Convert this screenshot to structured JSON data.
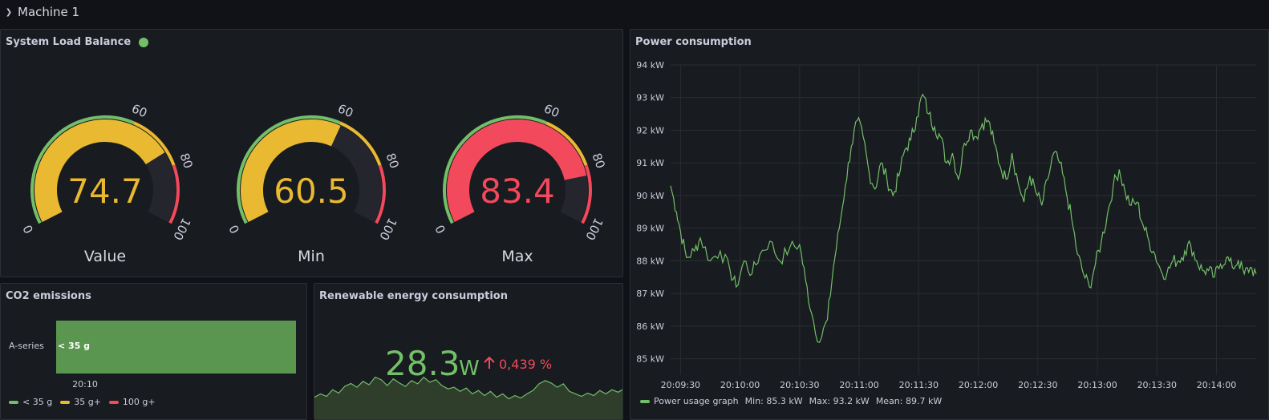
{
  "row": {
    "title": "Machine 1",
    "chevron_icon": "chevron-down-icon"
  },
  "colors": {
    "green": "#73bf69",
    "yellow": "#e8b931",
    "red": "#f2495c",
    "track": "#25262d"
  },
  "load_panel": {
    "title": "System Load Balance",
    "status_color": "#73bf69",
    "gauges": [
      {
        "label": "Value",
        "value": 74.7,
        "display": "74.7",
        "color": "#e8b931"
      },
      {
        "label": "Min",
        "value": 60.5,
        "display": "60.5",
        "color": "#e8b931"
      },
      {
        "label": "Max",
        "value": 83.4,
        "display": "83.4",
        "color": "#f2495c"
      }
    ],
    "min": 0,
    "max": 100,
    "thresholds": [
      {
        "from": 0,
        "to": 60,
        "color": "#73bf69"
      },
      {
        "from": 60,
        "to": 80,
        "color": "#e8b931"
      },
      {
        "from": 80,
        "to": 100,
        "color": "#f2495c"
      }
    ],
    "tick_labels": [
      "0",
      "60",
      "80",
      "100"
    ]
  },
  "co2_panel": {
    "title": "CO2 emissions",
    "series_label": "A-series",
    "bar_label": "< 35 g",
    "bar_color": "#5b9650",
    "x_tick": "20:10",
    "legend": [
      {
        "label": "< 35 g",
        "color": "#73bf69"
      },
      {
        "label": "35 g+",
        "color": "#e8b931"
      },
      {
        "label": "100 g+",
        "color": "#f2495c"
      }
    ]
  },
  "renew_panel": {
    "title": "Renewable energy consumption",
    "value": "28.3",
    "unit": "W",
    "change": "0,439 %",
    "value_color": "#73bf69",
    "change_color": "#f2495c",
    "arrow_icon": "arrow-up-icon"
  },
  "power_panel": {
    "title": "Power consumption",
    "legend": {
      "name": "Power usage graph",
      "min": "Min: 85.3 kW",
      "max": "Max: 93.2 kW",
      "mean": "Mean: 89.7 kW",
      "color": "#73bf69"
    }
  },
  "chart_data": [
    {
      "type": "line",
      "title": "Power consumption",
      "ylim": [
        84.5,
        94
      ],
      "y_ticks": [
        "85 kW",
        "86 kW",
        "87 kW",
        "88 kW",
        "89 kW",
        "90 kW",
        "91 kW",
        "92 kW",
        "93 kW",
        "94 kW"
      ],
      "x_ticks": [
        "20:09:30",
        "20:10:00",
        "20:10:30",
        "20:11:00",
        "20:11:30",
        "20:12:00",
        "20:12:30",
        "20:13:00",
        "20:13:30",
        "20:14:00"
      ],
      "x_tick_seconds": [
        0,
        30,
        60,
        90,
        120,
        150,
        180,
        210,
        240,
        270
      ],
      "x_range_seconds": [
        -5,
        290
      ],
      "grid": true,
      "series": [
        {
          "name": "Power usage graph",
          "color": "#73bf69",
          "x": [
            -5,
            -2,
            0,
            3,
            7,
            10,
            15,
            20,
            25,
            28,
            32,
            36,
            40,
            45,
            50,
            55,
            60,
            63,
            66,
            70,
            74,
            77,
            80,
            83,
            86,
            89,
            92,
            95,
            98,
            101,
            104,
            107,
            110,
            113,
            116,
            119,
            122,
            125,
            128,
            131,
            134,
            137,
            140,
            143,
            146,
            149,
            152,
            155,
            158,
            161,
            164,
            167,
            170,
            173,
            176,
            179,
            182,
            185,
            188,
            191,
            194,
            197,
            200,
            203,
            206,
            209,
            212,
            215,
            218,
            221,
            224,
            227,
            230,
            233,
            236,
            239,
            242,
            245,
            248,
            251,
            254,
            257,
            260,
            263,
            266,
            269,
            272,
            275,
            278,
            281,
            284,
            287,
            290
          ],
          "y": [
            90.3,
            89.5,
            88.9,
            88.1,
            88.3,
            88.7,
            88.0,
            88.3,
            87.7,
            87.2,
            88.0,
            87.6,
            88.2,
            88.6,
            88.0,
            88.4,
            88.5,
            87.4,
            86.4,
            85.5,
            86.2,
            87.8,
            89.0,
            90.3,
            91.5,
            92.3,
            91.8,
            90.7,
            90.2,
            91.0,
            90.5,
            90.0,
            90.6,
            91.4,
            91.7,
            92.4,
            93.1,
            92.5,
            92.1,
            91.8,
            91.0,
            91.3,
            90.5,
            91.6,
            92.0,
            91.8,
            92.2,
            92.3,
            91.6,
            90.9,
            90.5,
            91.3,
            90.4,
            89.8,
            90.6,
            90.1,
            89.7,
            90.5,
            91.3,
            91.0,
            90.2,
            89.3,
            88.2,
            87.6,
            87.2,
            87.9,
            88.6,
            89.4,
            90.3,
            90.8,
            90.1,
            89.7,
            89.8,
            89.1,
            88.6,
            88.2,
            87.7,
            87.6,
            88.0,
            88.0,
            88.3,
            88.5,
            88.0,
            87.7,
            87.7,
            87.5,
            87.9,
            88.1,
            87.8,
            88.0,
            87.6,
            87.8,
            87.6
          ]
        }
      ]
    },
    {
      "type": "area",
      "title": "Renewable energy consumption",
      "series": [
        {
          "values": [
            2.2,
            3.0,
            2.4,
            4.0,
            3.2,
            4.8,
            5.5,
            4.6,
            6.0,
            5.2,
            7.0,
            6.4,
            5.0,
            6.6,
            5.6,
            4.8,
            6.2,
            5.4,
            7.0,
            5.8,
            6.4,
            5.0,
            4.2,
            4.6,
            3.6,
            4.4,
            3.0,
            3.8,
            2.6,
            3.6,
            2.2,
            3.0,
            1.8,
            2.6,
            2.0,
            3.0,
            3.8,
            5.4,
            6.2,
            5.6,
            4.6,
            5.4,
            3.6,
            3.0,
            2.4,
            3.2,
            2.6,
            3.8,
            3.0,
            4.0,
            3.4,
            4.2
          ]
        }
      ]
    },
    {
      "type": "bar",
      "title": "CO2 emissions",
      "categories": [
        "A-series"
      ],
      "values": [
        35
      ],
      "xlabel": "20:10"
    }
  ]
}
